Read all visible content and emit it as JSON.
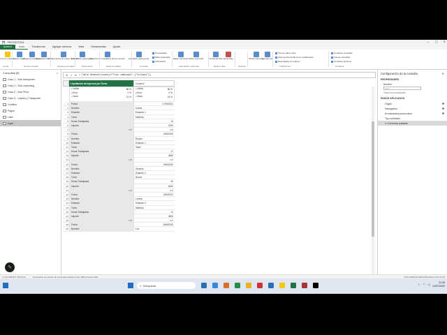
{
  "window": {
    "title": "PROYECTO01",
    "minimize": "—",
    "maximize": "▢",
    "close": "✕"
  },
  "menu": {
    "file": "Archivo",
    "tabs": [
      "Inicio",
      "Transformar",
      "Agregar columna",
      "Vista",
      "Herramientas",
      "Ayuda"
    ]
  },
  "ribbon": {
    "buttons": [
      {
        "label": "Cerrar y aplicar",
        "color": "#f2c811"
      },
      {
        "label": "Nuevo origen",
        "color": "#5a8ccb"
      },
      {
        "label": "Orígenes recientes",
        "color": "#5a8ccb"
      },
      {
        "label": "Especificar datos",
        "color": "#5a8ccb"
      },
      {
        "label": "Configuración de origen de datos",
        "color": "#5a8ccb"
      },
      {
        "label": "Administrar parámetros",
        "color": "#5a8ccb"
      },
      {
        "label": "Exportar los resultados de la consulta",
        "color": "#5a8ccb"
      },
      {
        "label": "Actualizar vista previa",
        "color": "#5a8ccb"
      },
      {
        "label": "Elegir columnas",
        "color": "#5a8ccb"
      },
      {
        "label": "Quitar columnas",
        "color": "#5a8ccb"
      },
      {
        "label": "Conservar filas",
        "color": "#5a8ccb"
      },
      {
        "label": "Quitar filas",
        "color": "#c0504d"
      },
      {
        "label": "Dividir columna",
        "color": "#5a8ccb"
      },
      {
        "label": "Agrupar por",
        "color": "#5a8ccb"
      }
    ],
    "small": [
      "Propiedades",
      "Editor avanzado",
      "Administrar",
      "Tipo de datos: Auto",
      "Usar la primera fila como encabezado",
      "Reemplazar los valores",
      "Combinar consultas",
      "Anexar consultas",
      "Combinar archivos"
    ],
    "groups": [
      "Cerrar",
      "Nueva consulta",
      "Orígenes de datos",
      "Parámetros",
      "Datos de salida",
      "Consulta",
      "Administrar columnas",
      "Reducir filas",
      "Ordenar",
      "Transformar",
      "Combinar"
    ]
  },
  "queries": {
    "title": "Consultas [9]",
    "collapse": "<",
    "items": [
      {
        "label": "Caso 1 - Solo transponer",
        "selected": false
      },
      {
        "label": "Caso 2 - Solo unpivoting",
        "selected": false
      },
      {
        "label": "Caso 2 - Solo Pivot",
        "selected": false
      },
      {
        "label": "Caso 3 - Unpivot y Transponer",
        "selected": false
      },
      {
        "label": "Créditos",
        "selected": false
      },
      {
        "label": "Pagos",
        "selected": false
      },
      {
        "label": "Lista",
        "selected": false
      },
      {
        "label": "Ingre",
        "selected": true
      }
    ]
  },
  "formula": {
    "fx": "fx",
    "text": "= Table.RemoveColumns(#\"Tipo cambiado\",{\"Column1\"})"
  },
  "grid": {
    "headers": [
      "Liquidación de Ingresos por Turno",
      "Column2"
    ],
    "stats": [
      {
        "valid": "Válido",
        "valid_pct": "86 %",
        "error": "Error",
        "error_pct": "0 %",
        "empty": "Vacío",
        "empty_pct": "14 %"
      },
      {
        "valid": "Válido",
        "valid_pct": "86 %",
        "error": "Error",
        "error_pct": "0 %",
        "empty": "Vacío",
        "empty_pct": "14 %"
      }
    ],
    "rows": [
      [
        "1",
        "Fecha",
        "",
        "17/05/2021",
        "num"
      ],
      [
        "2",
        "Nombre",
        "",
        "Carlos",
        "txt"
      ],
      [
        "3",
        "Estación",
        "",
        "Estación 1",
        "txt"
      ],
      [
        "4",
        "Turno",
        "",
        "Mañana",
        "txt"
      ],
      [
        "5",
        "Horas Trabajadas",
        "",
        "10",
        "num"
      ],
      [
        "6",
        "Importe",
        "",
        "2000",
        "num"
      ],
      [
        "7",
        "null",
        "nul",
        "null",
        "nul"
      ],
      [
        "8",
        "Fecha",
        "",
        "2/06/2020",
        "num"
      ],
      [
        "9",
        "Nombre",
        "",
        "Rocino",
        "txt"
      ],
      [
        "10",
        "Estación",
        "",
        "Estación 1",
        "txt"
      ],
      [
        "11",
        "Turno",
        "",
        "Tarde",
        "txt"
      ],
      [
        "12",
        "Horas Trabajadas",
        "",
        "17",
        "num"
      ],
      [
        "13",
        "Importe",
        "",
        "4660",
        "num"
      ],
      [
        "14",
        "null",
        "nul",
        "null",
        "nul"
      ],
      [
        "15",
        "Fecha",
        "",
        "3/06/2020",
        "num"
      ],
      [
        "16",
        "Nombre",
        "",
        "Gerardo",
        "txt"
      ],
      [
        "17",
        "Estación",
        "",
        "Estación 2",
        "txt"
      ],
      [
        "18",
        "Turno",
        "",
        "Noche",
        "txt"
      ],
      [
        "19",
        "Horas Trabajadas",
        "",
        "30",
        "num"
      ],
      [
        "20",
        "Importe",
        "",
        "6000",
        "num"
      ],
      [
        "21",
        "null",
        "nul",
        "null",
        "nul"
      ],
      [
        "22",
        "Fecha",
        "",
        "4/06/2021",
        "num"
      ],
      [
        "23",
        "Nombre",
        "",
        "Lorena",
        "txt"
      ],
      [
        "24",
        "Estación",
        "",
        "Estación 2",
        "txt"
      ],
      [
        "25",
        "Turno",
        "",
        "Mañana",
        "txt"
      ],
      [
        "26",
        "Horas Trabajadas",
        "",
        "12",
        "num"
      ],
      [
        "27",
        "Importe",
        "",
        "4800",
        "num"
      ],
      [
        "28",
        "null",
        "nul",
        "null",
        "nul"
      ],
      [
        "29",
        "Fecha",
        "",
        "5/06/2020",
        "num"
      ],
      [
        "30",
        "Nombre",
        "",
        "Luz",
        "txt"
      ]
    ]
  },
  "settings": {
    "title": "Configuración de la consulta",
    "close": "✕",
    "props_head": "PROPIEDADES",
    "name_label": "Nombre",
    "name_value": "Ingre",
    "all_props": "Todas las propiedades",
    "steps_head": "PASOS APLICADOS",
    "steps": [
      {
        "label": "Origen",
        "gear": true,
        "selected": false
      },
      {
        "label": "Navegación",
        "gear": true,
        "selected": false
      },
      {
        "label": "Encabezados promovidos",
        "gear": true,
        "selected": false
      },
      {
        "label": "Tipo cambiado",
        "gear": false,
        "selected": false
      },
      {
        "label": "✕ Columnas quitadas",
        "gear": false,
        "selected": true
      }
    ]
  },
  "status": {
    "left1": "2 COLUMNAS, 30 FILAS",
    "left2": "Generación de perfiles de columnas basada en las 1000 primeras filas",
    "right": "VISTA PREVIA DESCARGADA A LAS 21:25"
  },
  "taskbar": {
    "search": "Búsqueda",
    "time": "21:26",
    "date": "11/07/2020",
    "icons": [
      "#2b6fb3",
      "#3a86d9",
      "#d96f2b",
      "#2b8a4a",
      "#e8b51f",
      "#c33",
      "#2b6fb3",
      "#f2c811",
      "#217346",
      "#a33",
      "#000"
    ]
  },
  "fab": "✎"
}
